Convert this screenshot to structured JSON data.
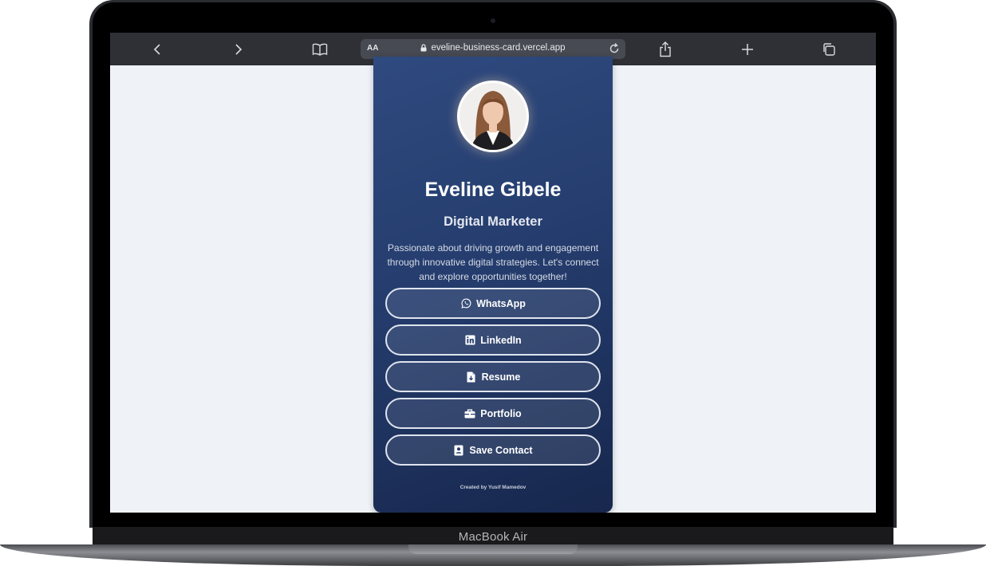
{
  "device": {
    "label": "MacBook Air"
  },
  "browser": {
    "aa_label": "AA",
    "url": "eveline-business-card.vercel.app",
    "icons": [
      "back-icon",
      "forward-icon",
      "bookmarks-icon",
      "lock-icon",
      "reload-icon",
      "share-icon",
      "new-tab-icon",
      "tabs-icon"
    ]
  },
  "card": {
    "name": "Eveline Gibele",
    "title": "Digital Marketer",
    "bio": "Passionate about driving growth and engagement through innovative digital strategies. Let's connect and explore opportunities together!",
    "buttons": [
      {
        "label": "WhatsApp",
        "icon": "whatsapp-icon"
      },
      {
        "label": "LinkedIn",
        "icon": "linkedin-icon"
      },
      {
        "label": "Resume",
        "icon": "resume-file-icon"
      },
      {
        "label": "Portfolio",
        "icon": "briefcase-icon"
      },
      {
        "label": "Save Contact",
        "icon": "contact-card-icon"
      }
    ],
    "credit": "Created by Yusif Mamedov"
  },
  "colors": {
    "card_gradient_top": "#2f4a7f",
    "card_gradient_bottom": "#17274d",
    "page_background": "#eff3f8",
    "toolbar": "#2e3036"
  }
}
